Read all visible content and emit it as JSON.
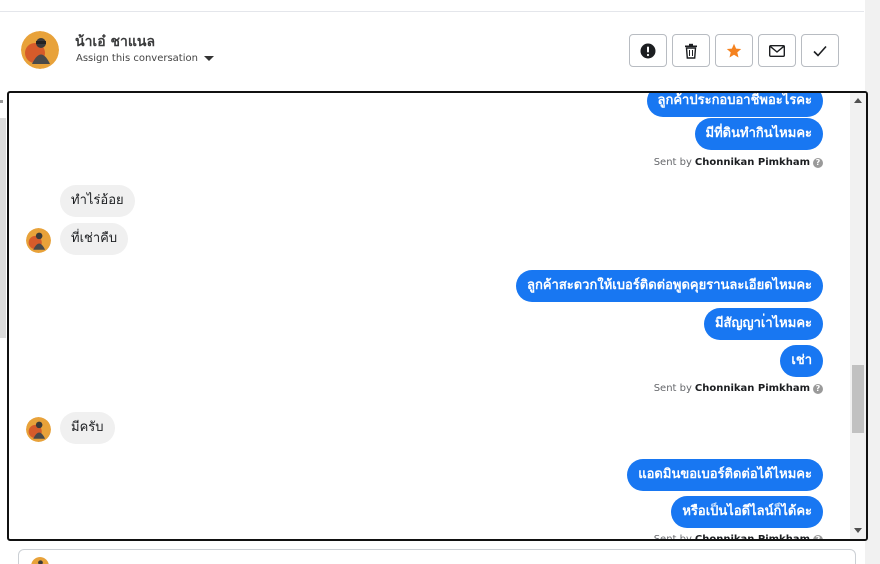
{
  "header": {
    "contact_name": "น้าเอ๋ ชาแนล",
    "assign_label": "Assign this conversation",
    "actions": [
      {
        "icon": "exclamation-icon"
      },
      {
        "icon": "trash-icon"
      },
      {
        "icon": "star-icon",
        "color": "#f5821f"
      },
      {
        "icon": "envelope-icon"
      },
      {
        "icon": "checkmark-icon"
      }
    ]
  },
  "conversation": {
    "messages": [
      {
        "direction": "out",
        "text": "ลูกค้าประกอบอาชีพอะไรคะ"
      },
      {
        "direction": "out",
        "text": "มีที่ดินทำกินไหมคะ"
      },
      {
        "direction": "in",
        "text": "ทำไร่อ้อย"
      },
      {
        "direction": "in",
        "text": "ที่เช่าคืบ"
      },
      {
        "direction": "out",
        "text": "ลูกค้าสะดวกให้เบอร์ติดต่อพูดคุยรานละเอียดไหมคะ"
      },
      {
        "direction": "out",
        "text": "มีสัญญาเ่าไหมคะ"
      },
      {
        "direction": "out",
        "text": "เช่า"
      },
      {
        "direction": "in",
        "text": "มีครับ"
      },
      {
        "direction": "out",
        "text": "แอดมินขอเบอร์ติดต่อได้ไหมคะ"
      },
      {
        "direction": "out",
        "text": "หรือเป็นไอดีไลน์ก็ได้คะ"
      }
    ],
    "sent_by_prefix": "Sent by",
    "sent_by_name": "Chonnikan Pimkham",
    "help_glyph": "?"
  },
  "colors": {
    "outgoing_bubble": "#1877f2",
    "incoming_bubble": "#f0f0f0",
    "star": "#f5821f"
  }
}
